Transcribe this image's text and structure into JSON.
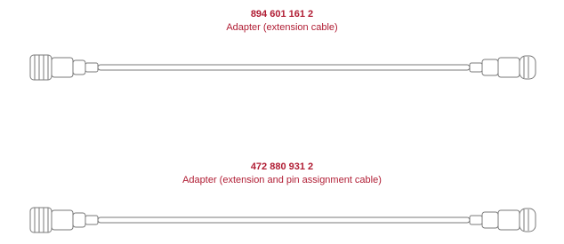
{
  "colors": {
    "accent": "#b01c33",
    "illustration": "#7a7a7a"
  },
  "items": [
    {
      "part_number": "894 601 161 2",
      "description": "Adapter (extension cable)",
      "image": "extension-cable-illustration"
    },
    {
      "part_number": "472 880 931 2",
      "description": "Adapter (extension and pin assignment cable)",
      "image": "extension-cable-illustration"
    }
  ]
}
